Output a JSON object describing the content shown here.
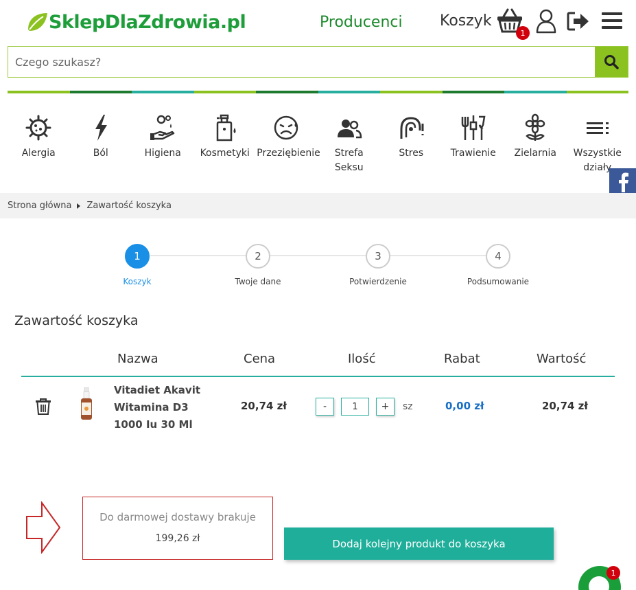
{
  "header": {
    "logo_text": "SklepDlaZdrowia.pl",
    "producers_label": "Producenci",
    "cart_label": "Koszyk",
    "cart_count": "1"
  },
  "search": {
    "placeholder": "Czego szukasz?"
  },
  "stripe_colors": [
    "#8bc21f",
    "#1e7a2e",
    "#27ae9e",
    "#8bc21f",
    "#1e7a2e",
    "#27ae9e",
    "#8bc21f",
    "#1e7a2e",
    "#27ae9e",
    "#8bc21f"
  ],
  "categories": [
    {
      "label": "Alergia",
      "icon": "virus-icon"
    },
    {
      "label": "Ból",
      "icon": "lightning-icon"
    },
    {
      "label": "Higiena",
      "icon": "hand-wash-icon"
    },
    {
      "label": "Kosmetyki",
      "icon": "cosmetic-bottle-icon"
    },
    {
      "label": "Przeziębienie",
      "icon": "sick-face-icon"
    },
    {
      "label": "Strefa Seksu",
      "icon": "couple-icon"
    },
    {
      "label": "Stres",
      "icon": "stress-head-icon"
    },
    {
      "label": "Trawienie",
      "icon": "cutlery-icon"
    },
    {
      "label": "Zielarnia",
      "icon": "flower-icon"
    },
    {
      "label": "Wszystkie działy",
      "icon": "list-icon"
    }
  ],
  "breadcrumb": {
    "home": "Strona główna",
    "current": "Zawartość koszyka"
  },
  "steps": [
    {
      "number": "1",
      "label": "Koszyk",
      "active": true
    },
    {
      "number": "2",
      "label": "Twoje dane",
      "active": false
    },
    {
      "number": "3",
      "label": "Potwierdzenie",
      "active": false
    },
    {
      "number": "4",
      "label": "Podsumowanie",
      "active": false
    }
  ],
  "cart": {
    "title": "Zawartość koszyka",
    "columns": {
      "name": "Nazwa",
      "price": "Cena",
      "qty": "Ilość",
      "discount": "Rabat",
      "value": "Wartość"
    },
    "items": [
      {
        "name": "Vitadiet Akavit Witamina D3 1000 Iu 30 Ml",
        "price": "20,74 zł",
        "qty": "1",
        "unit": "sz",
        "discount": "0,00 zł",
        "value": "20,74 zł"
      }
    ],
    "minus_label": "-",
    "plus_label": "+"
  },
  "free_delivery": {
    "label": "Do darmowej dostawy brakuje",
    "amount": "199,26 zł"
  },
  "add_button_label": "Dodaj kolejny produkt do koszyka",
  "chat_badge": "1"
}
